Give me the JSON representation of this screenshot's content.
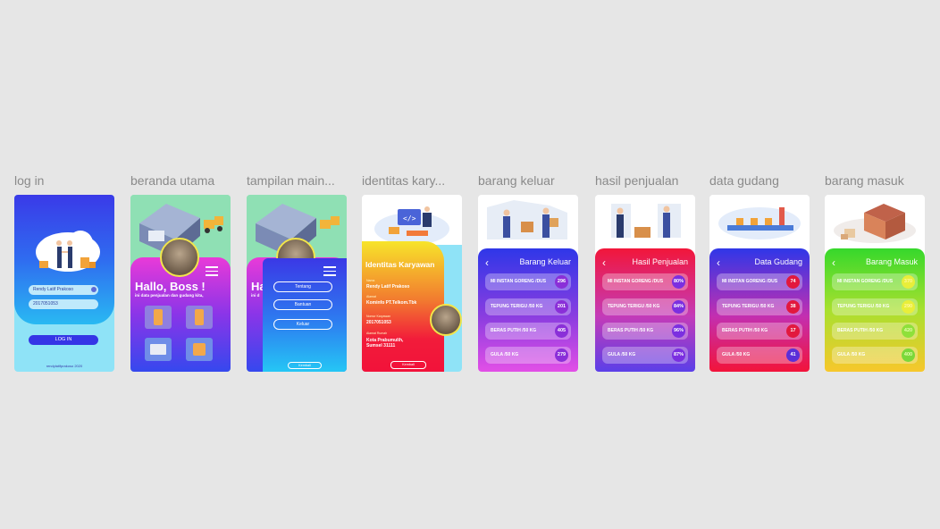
{
  "frames": {
    "login": "log in",
    "beranda": "beranda utama",
    "menu": "tampilan main...",
    "identitas": "identitas kary...",
    "keluar": "barang keluar",
    "penjualan": "hasil penjualan",
    "gudang": "data gudang",
    "masuk": "barang masuk"
  },
  "login": {
    "username": "Rendy Latif Prakoso",
    "password": "2017051053",
    "button": "LOG IN",
    "footer": "rendylatifprakoso 2020"
  },
  "beranda": {
    "greeting": "Hallo, Boss !",
    "subtitle": "ini data penjualan dan gudang kita,"
  },
  "menu": {
    "greeting_partial": "Ha",
    "subtitle_partial": "ini d",
    "items": [
      "Tentang",
      "Bantuan",
      "Keluar"
    ],
    "back": "Kembali"
  },
  "identitas": {
    "title": "Identitas Karyawan",
    "fields": [
      {
        "label": "Nama",
        "value": "Rendy Latif Prakoso"
      },
      {
        "label": "Alamat",
        "value": "Kominfo PT.Telkom.Tbk"
      },
      {
        "label": "Nomor Karyawan",
        "value": "2017051053"
      },
      {
        "label": "Alamat Rumah",
        "value": "Kota Prabumulih, Sumsel 31111"
      }
    ],
    "back": "Kembali"
  },
  "keluar": {
    "title": "Barang Keluar",
    "back_icon": "‹",
    "rows": [
      {
        "label": "MI INSTAN GORENG /DUS",
        "value": "296"
      },
      {
        "label": "TEPUNG TERIGU /50 KG",
        "value": "201"
      },
      {
        "label": "BERAS PUTIH /50 KG",
        "value": "405"
      },
      {
        "label": "GULA /50 KG",
        "value": "279"
      }
    ]
  },
  "penjualan": {
    "title": "Hasil Penjualan",
    "back_icon": "‹",
    "rows": [
      {
        "label": "MI INSTAN GORENG /DUS",
        "value": "80%"
      },
      {
        "label": "TEPUNG TERIGU /50 KG",
        "value": "84%"
      },
      {
        "label": "BERAS PUTIH /50 KG",
        "value": "96%"
      },
      {
        "label": "GULA /50 KG",
        "value": "87%"
      }
    ]
  },
  "gudang": {
    "title": "Data Gudang",
    "back_icon": "‹",
    "rows": [
      {
        "label": "MI INSTAN GORENG /DUS",
        "value": "74"
      },
      {
        "label": "TEPUNG TERIGU /50 KG",
        "value": "38"
      },
      {
        "label": "BERAS PUTIH /50 KG",
        "value": "17"
      },
      {
        "label": "GULA /50 KG",
        "value": "41"
      }
    ]
  },
  "masuk": {
    "title": "Barang Masuk",
    "back_icon": "‹",
    "rows": [
      {
        "label": "MI INSTAN GORENG /DUS",
        "value": "370"
      },
      {
        "label": "TEPUNG TERIGU /50 KG",
        "value": "290"
      },
      {
        "label": "BERAS PUTIH /50 KG",
        "value": "420"
      },
      {
        "label": "GULA /50 KG",
        "value": "400"
      }
    ]
  },
  "colors": {
    "canvas": "#e6e6e6",
    "blue": "#2f3fe8",
    "magenta": "#e93ad8",
    "red": "#f21c39",
    "green": "#3ee02f",
    "yellow": "#f5e52a"
  }
}
